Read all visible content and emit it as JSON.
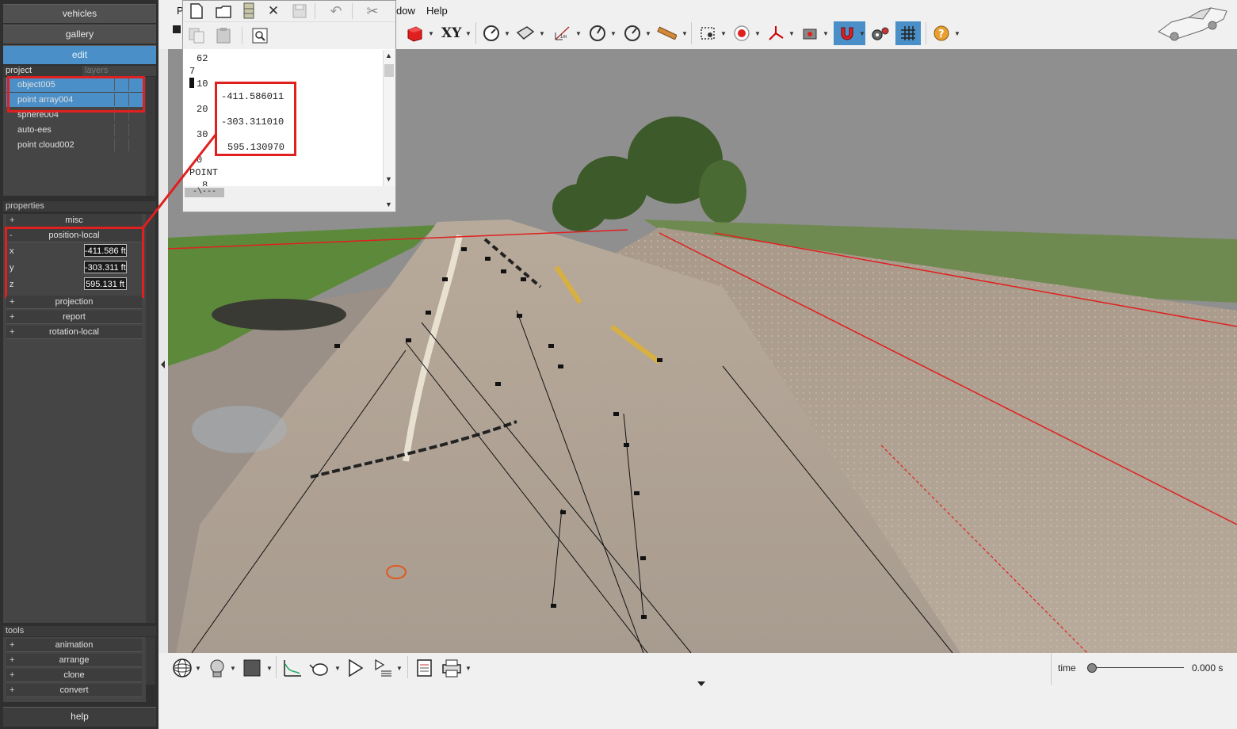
{
  "left_panel": {
    "nav": {
      "vehicles": "vehicles",
      "gallery": "gallery",
      "edit": "edit",
      "help": "help"
    },
    "tabs": {
      "project": "project",
      "layers": "layers"
    },
    "objects": [
      "object005",
      "point array004",
      "sphere004",
      "auto-ees",
      "point cloud002"
    ],
    "properties": {
      "header": "properties",
      "misc": "misc",
      "position_local": "position-local",
      "x_label": "x",
      "y_label": "y",
      "z_label": "z",
      "x_value": "-411.586 ft",
      "y_value": "-303.311 ft",
      "z_value": "595.131 ft",
      "projection": "projection",
      "report": "report",
      "rotation_local": "rotation-local",
      "plus": "+",
      "minus": "-"
    },
    "tools": {
      "header": "tools",
      "items": [
        "animation",
        "arrange",
        "clone",
        "convert"
      ]
    }
  },
  "menu": {
    "p": "P",
    "window": "dow",
    "help": "Help"
  },
  "toolbar": {
    "xy_label": "XY",
    "colors": {
      "active_tool": "#4a8fc7",
      "accent_red": "#e0201f"
    }
  },
  "editor": {
    "lines": [
      "62",
      "7",
      "10",
      "20",
      "30",
      "0",
      "POINT",
      "8"
    ],
    "values": [
      "-411.586011",
      "-303.311010",
      "595.130970"
    ],
    "status": "-\\---"
  },
  "timeline": {
    "label": "time",
    "value": "0.000 s"
  }
}
